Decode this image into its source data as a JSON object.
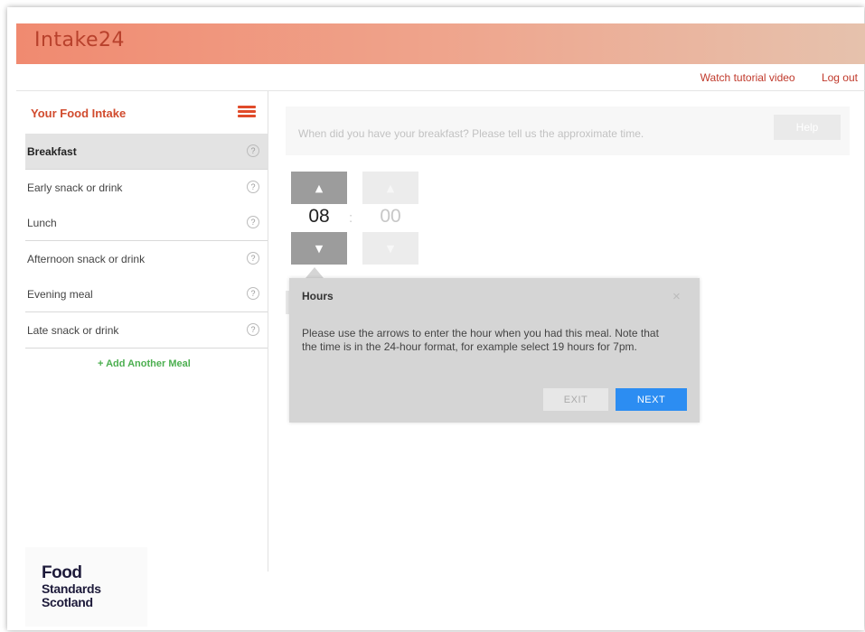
{
  "app": {
    "title": "Intake24"
  },
  "topnav": {
    "tutorial": "Watch tutorial video",
    "logout": "Log out"
  },
  "sidebar": {
    "title": "Your Food Intake",
    "menu_icon": "hamburger-icon",
    "items": [
      {
        "label": "Breakfast",
        "active": true
      },
      {
        "label": "Early snack or drink"
      },
      {
        "label": "Lunch"
      },
      {
        "label": "Afternoon snack or drink"
      },
      {
        "label": "Evening meal"
      },
      {
        "label": "Late snack or drink"
      }
    ],
    "help_glyph": "?",
    "add_meal": "+ Add Another Meal"
  },
  "question": {
    "text": "When did you have your breakfast? Please tell us the approximate time.",
    "help": "Help"
  },
  "time": {
    "hours": "08",
    "separator": ":",
    "minutes": "00",
    "up_glyph": "▲",
    "down_glyph": "▼"
  },
  "tooltip": {
    "title": "Hours",
    "body": "Please use the arrows to enter the hour when you had this meal. Note that the time is in the 24-hour format, for example select 19 hours for 7pm.",
    "close_glyph": "×",
    "exit": "EXIT",
    "next": "NEXT"
  },
  "logo": {
    "line1": "Food",
    "line2": "Standards",
    "line3": "Scotland"
  },
  "colors": {
    "accent": "#d14b2e",
    "next_blue": "#2c8df2",
    "add_green": "#4caf50"
  }
}
